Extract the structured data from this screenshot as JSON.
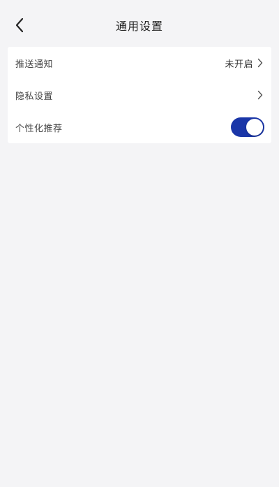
{
  "header": {
    "title": "通用设置",
    "back_icon": "chevron-left-icon"
  },
  "settings": {
    "items": [
      {
        "label": "推送通知",
        "value": "未开启",
        "icon": "chevron-right-icon"
      },
      {
        "label": "隐私设置",
        "value": "",
        "icon": "chevron-right-icon"
      },
      {
        "label": "个性化推荐",
        "toggle_on": true
      }
    ]
  },
  "colors": {
    "toggle_active": "#1a36a8",
    "background": "#f4f4f6",
    "card": "#ffffff"
  }
}
